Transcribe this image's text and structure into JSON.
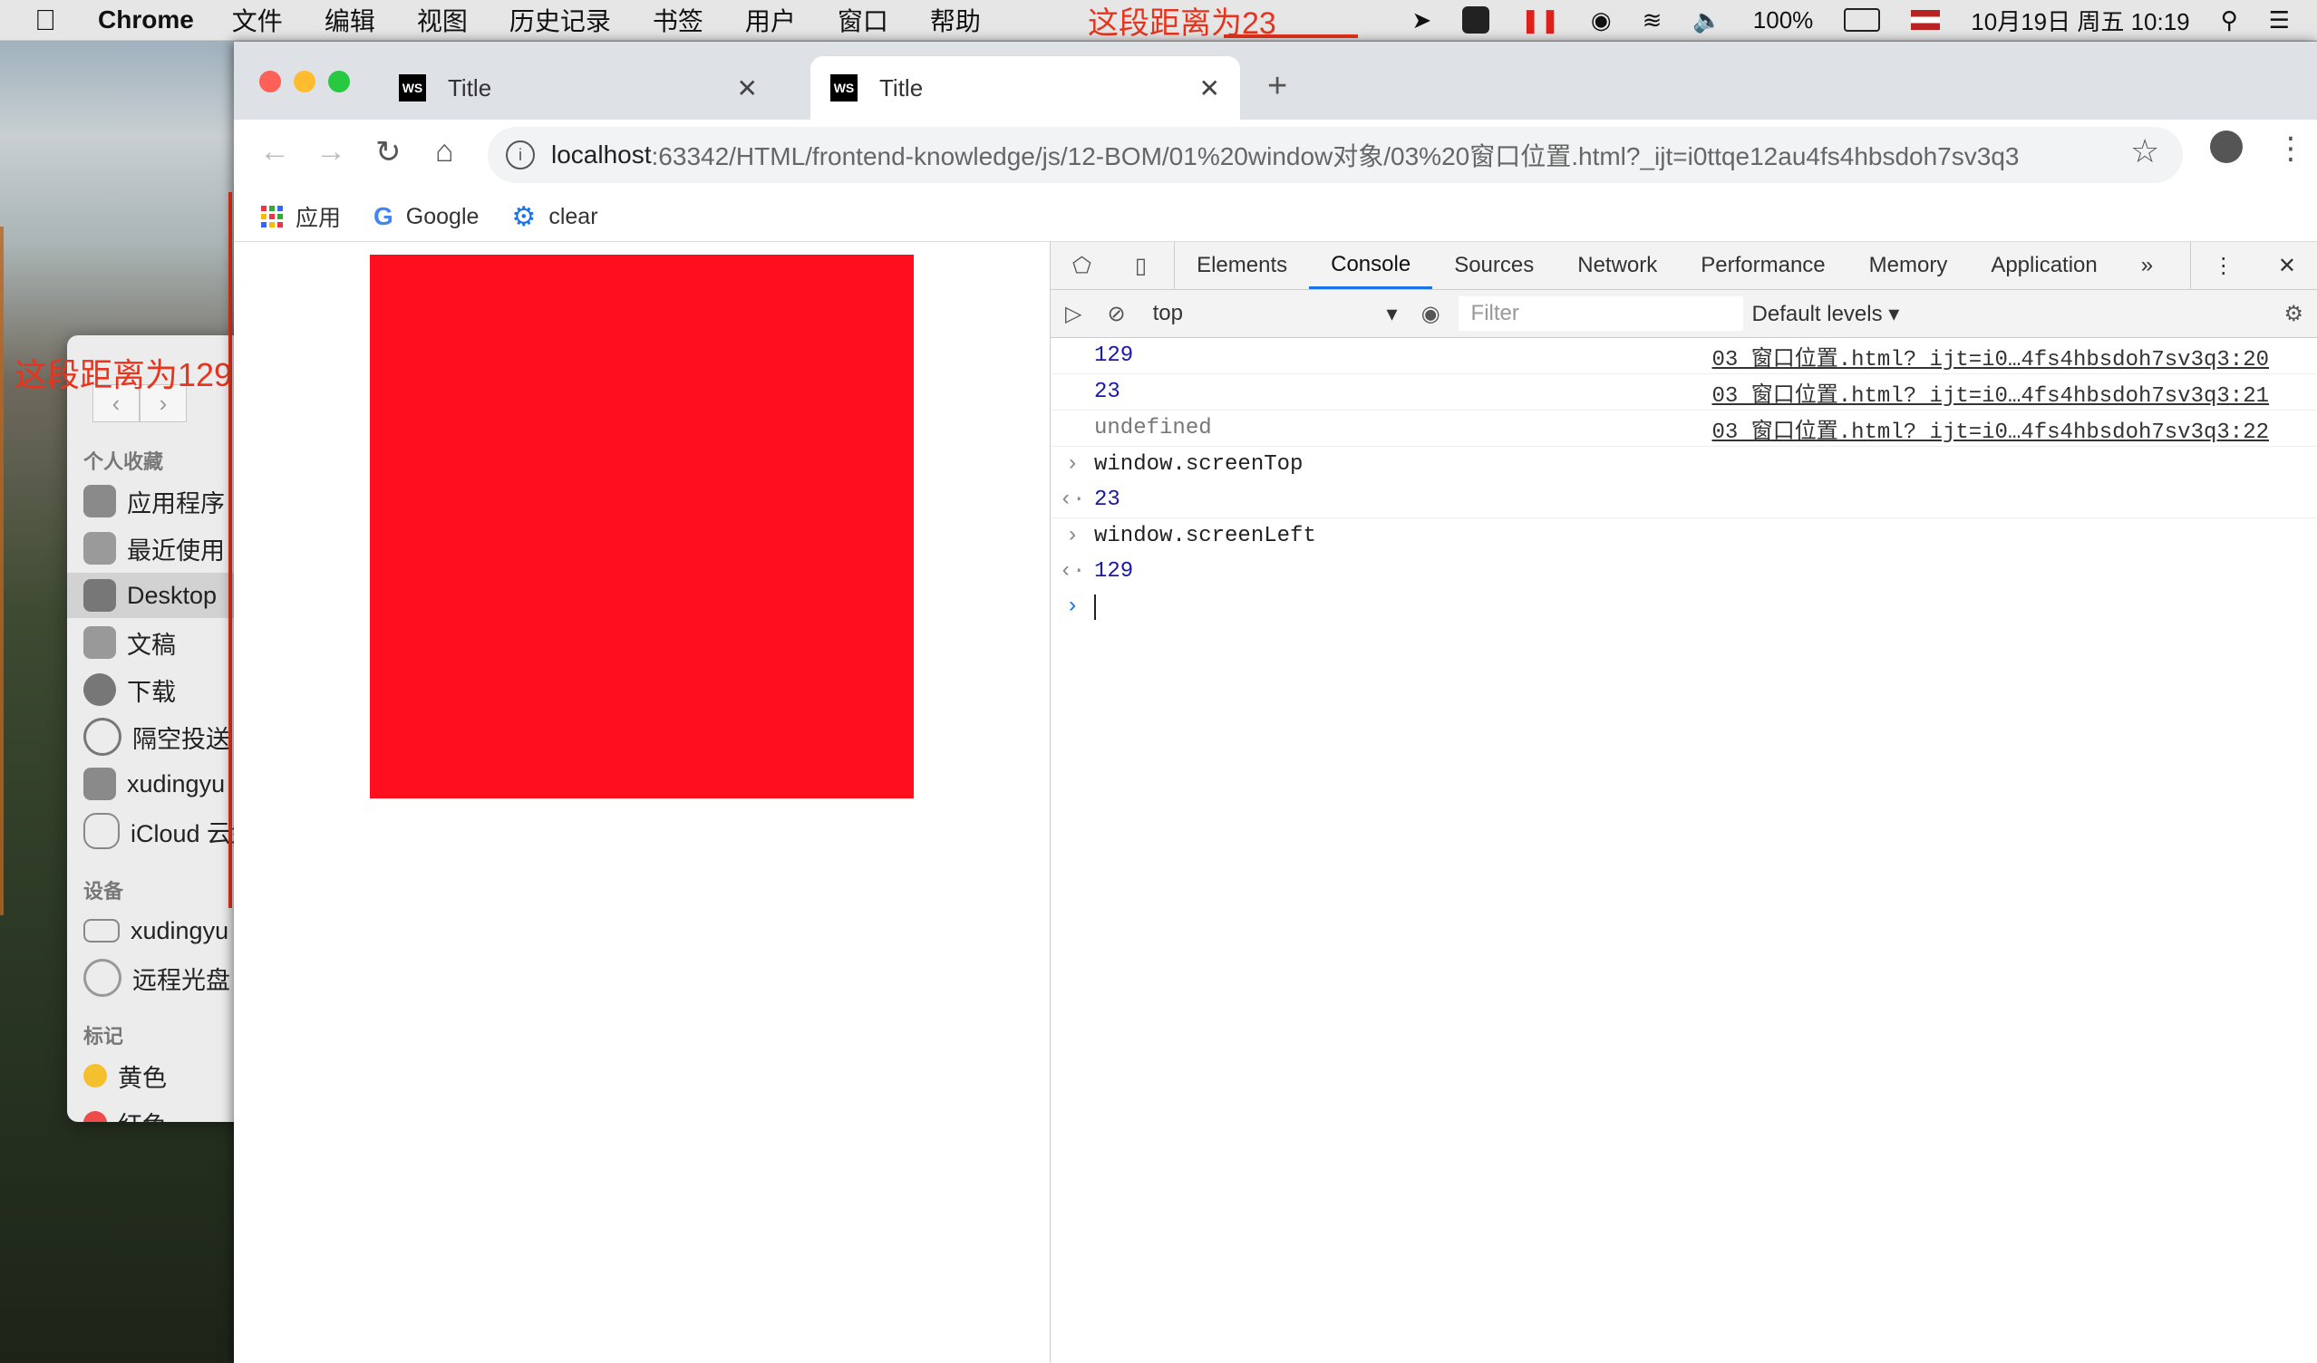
{
  "menubar": {
    "app_name": "Chrome",
    "menus": [
      "文件",
      "编辑",
      "视图",
      "历史记录",
      "书签",
      "用户",
      "窗口",
      "帮助"
    ],
    "battery": "100%",
    "datetime": "10月19日 周五 10:19"
  },
  "annotations": {
    "top_distance": "这段距离为23",
    "left_distance": "这段距离为129"
  },
  "finder": {
    "favorites_header": "个人收藏",
    "favorites": [
      "应用程序",
      "最近使用",
      "Desktop",
      "文稿",
      "下载",
      "隔空投送",
      "xudingyu",
      "iCloud 云盘"
    ],
    "devices_header": "设备",
    "devices": [
      "xudingyu",
      "远程光盘"
    ],
    "tags_header": "标记",
    "tags": [
      "黄色",
      "红色"
    ]
  },
  "chrome": {
    "tabs": [
      {
        "title": "Title",
        "favicon": "WS"
      },
      {
        "title": "Title",
        "favicon": "WS"
      }
    ],
    "url_host": "localhost",
    "url_path": ":63342/HTML/frontend-knowledge/js/12-BOM/01%20window对象/03%20窗口位置.html?_ijt=i0ttqe12au4fs4hbsdoh7sv3q3",
    "bookmarks": [
      "应用",
      "Google",
      "clear"
    ]
  },
  "devtools": {
    "tabs": [
      "Elements",
      "Console",
      "Sources",
      "Network",
      "Performance",
      "Memory",
      "Application"
    ],
    "active_tab": "Console",
    "context": "top",
    "filter_placeholder": "Filter",
    "levels": "Default levels",
    "log": [
      {
        "kind": "output",
        "text": "129",
        "source": "03 窗口位置.html? ijt=i0…4fs4hbsdoh7sv3q3:20"
      },
      {
        "kind": "output",
        "text": "23",
        "source": "03 窗口位置.html? ijt=i0…4fs4hbsdoh7sv3q3:21"
      },
      {
        "kind": "undefined",
        "text": "undefined",
        "source": "03 窗口位置.html? ijt=i0…4fs4hbsdoh7sv3q3:22"
      },
      {
        "kind": "input",
        "text": "window.screenTop"
      },
      {
        "kind": "result",
        "text": "23"
      },
      {
        "kind": "input",
        "text": "window.screenLeft"
      },
      {
        "kind": "result",
        "text": "129"
      }
    ]
  },
  "colors": {
    "annotation": "#e8341c",
    "red_box": "#ff0f1e",
    "console_number": "#1a1aa6",
    "devtools_active": "#1a73e8"
  }
}
